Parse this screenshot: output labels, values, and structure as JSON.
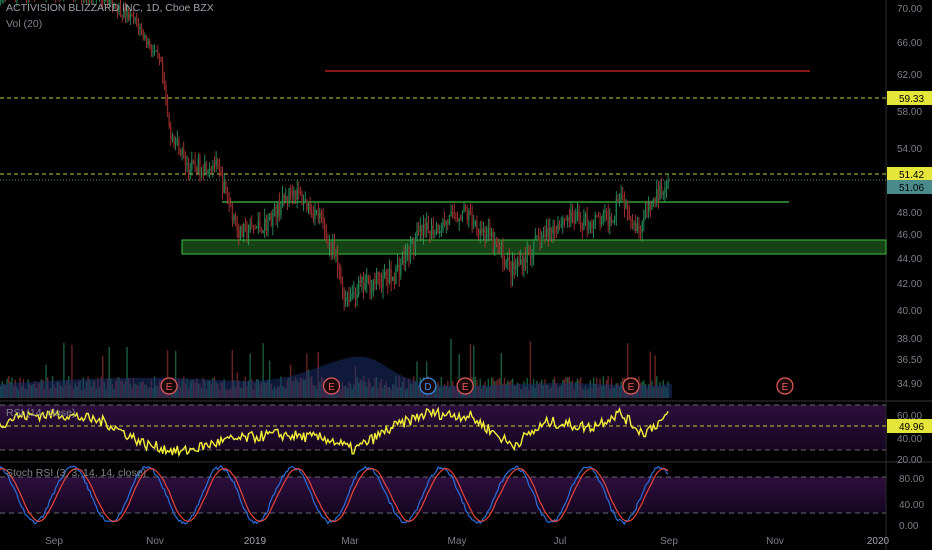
{
  "header": {
    "symbol_title": "ACTIVISION BLIZZARD INC, 1D, Cboe BZX",
    "volume_label": "Vol (20)",
    "rsi_label": "RSI (14, close)",
    "stoch_label": "Stoch RSI (3, 3, 14, 14, close)"
  },
  "colors": {
    "background": "#000000",
    "up": "#26a69a",
    "down": "#ef5350",
    "candle_up": "#1e7f4f",
    "candle_down": "#8b2626",
    "rsi_line": "#f5f03a",
    "stoch_k": "#2a6fdb",
    "stoch_d": "#e8453c",
    "support_zone": "#1f6b1f",
    "resistance_red": "#e02424",
    "price_line_yellow": "#d4d43a",
    "earnings_badge": "#e85a5a",
    "dividend_badge": "#3a8ee6"
  },
  "chart_data": [
    {
      "type": "candlestick",
      "title": "ACTIVISION BLIZZARD INC, 1D, Cboe BZX",
      "x_ticks": [
        "Sep",
        "Nov",
        "2019",
        "Mar",
        "May",
        "Jul",
        "Sep",
        "Nov",
        "2020"
      ],
      "y_ticks": [
        70.0,
        66.0,
        62.0,
        58.0,
        54.0,
        48.0,
        46.0,
        44.0,
        42.0,
        40.0,
        38.0,
        36.5,
        34.9
      ],
      "price_labels": [
        {
          "label": "59.33",
          "value": 59.33,
          "style": "yellow-dashed-line"
        },
        {
          "label": "51.42",
          "value": 51.42,
          "style": "yellow-dashed-line"
        },
        {
          "label": "51.06",
          "value": 51.06,
          "style": "last-price"
        }
      ],
      "levels": {
        "red_resistance": 62.2,
        "green_line": 48.7,
        "green_zone": [
          44.5,
          45.6
        ]
      },
      "approx_path": [
        {
          "x": "2018-07-20",
          "y": 71.0
        },
        {
          "x": "2018-08-15",
          "y": 72.0
        },
        {
          "x": "2018-09-10",
          "y": 72.0
        },
        {
          "x": "2018-10-01",
          "y": 71.5
        },
        {
          "x": "2018-10-20",
          "y": 68.0
        },
        {
          "x": "2018-11-03",
          "y": 63.0
        },
        {
          "x": "2018-11-08",
          "y": 56.0
        },
        {
          "x": "2018-11-20",
          "y": 52.0
        },
        {
          "x": "2018-12-05",
          "y": 52.5
        },
        {
          "x": "2018-12-20",
          "y": 46.0
        },
        {
          "x": "2019-01-05",
          "y": 47.0
        },
        {
          "x": "2019-01-20",
          "y": 50.0
        },
        {
          "x": "2019-02-05",
          "y": 47.5
        },
        {
          "x": "2019-02-14",
          "y": 44.0
        },
        {
          "x": "2019-02-20",
          "y": 41.0
        },
        {
          "x": "2019-03-05",
          "y": 42.0
        },
        {
          "x": "2019-03-20",
          "y": 42.5
        },
        {
          "x": "2019-04-05",
          "y": 46.0
        },
        {
          "x": "2019-04-20",
          "y": 47.0
        },
        {
          "x": "2019-05-01",
          "y": 48.0
        },
        {
          "x": "2019-05-15",
          "y": 46.0
        },
        {
          "x": "2019-05-30",
          "y": 43.0
        },
        {
          "x": "2019-06-15",
          "y": 45.5
        },
        {
          "x": "2019-06-30",
          "y": 47.5
        },
        {
          "x": "2019-07-15",
          "y": 47.0
        },
        {
          "x": "2019-07-28",
          "y": 47.5
        },
        {
          "x": "2019-08-01",
          "y": 50.0
        },
        {
          "x": "2019-08-12",
          "y": 46.5
        },
        {
          "x": "2019-08-20",
          "y": 48.5
        },
        {
          "x": "2019-08-30",
          "y": 51.2
        }
      ],
      "events": [
        {
          "label": "E",
          "x": "2018-11-08",
          "kind": "earnings"
        },
        {
          "label": "E",
          "x": "2019-02-12",
          "kind": "earnings"
        },
        {
          "label": "D",
          "x": "2019-04-10",
          "kind": "dividend"
        },
        {
          "label": "E",
          "x": "2019-05-02",
          "kind": "earnings"
        },
        {
          "label": "E",
          "x": "2019-08-08",
          "kind": "earnings"
        },
        {
          "label": "E",
          "x": "2019-11-07",
          "kind": "earnings"
        }
      ]
    },
    {
      "type": "line",
      "title": "RSI (14, close)",
      "y_ticks": [
        60.0,
        40.0,
        20.0
      ],
      "last_value_label": "49.96",
      "bands": [
        70,
        30
      ],
      "approx_path": [
        {
          "x": "2018-07-20",
          "y": 45
        },
        {
          "x": "2018-08-10",
          "y": 60
        },
        {
          "x": "2018-09-05",
          "y": 62
        },
        {
          "x": "2018-10-01",
          "y": 55
        },
        {
          "x": "2018-10-25",
          "y": 35
        },
        {
          "x": "2018-11-15",
          "y": 28
        },
        {
          "x": "2018-12-10",
          "y": 38
        },
        {
          "x": "2019-01-10",
          "y": 44
        },
        {
          "x": "2019-02-10",
          "y": 40
        },
        {
          "x": "2019-02-25",
          "y": 30
        },
        {
          "x": "2019-03-20",
          "y": 50
        },
        {
          "x": "2019-04-10",
          "y": 63
        },
        {
          "x": "2019-05-05",
          "y": 60
        },
        {
          "x": "2019-05-30",
          "y": 34
        },
        {
          "x": "2019-06-20",
          "y": 55
        },
        {
          "x": "2019-07-15",
          "y": 50
        },
        {
          "x": "2019-08-01",
          "y": 63
        },
        {
          "x": "2019-08-15",
          "y": 45
        },
        {
          "x": "2019-08-30",
          "y": 60
        }
      ]
    },
    {
      "type": "line",
      "title": "Stoch RSI (3, 3, 14, 14, close)",
      "y_ticks": [
        80.0,
        40.0,
        0.0
      ],
      "series": [
        {
          "name": "K"
        },
        {
          "name": "D"
        }
      ],
      "bands": [
        80,
        20
      ]
    }
  ]
}
